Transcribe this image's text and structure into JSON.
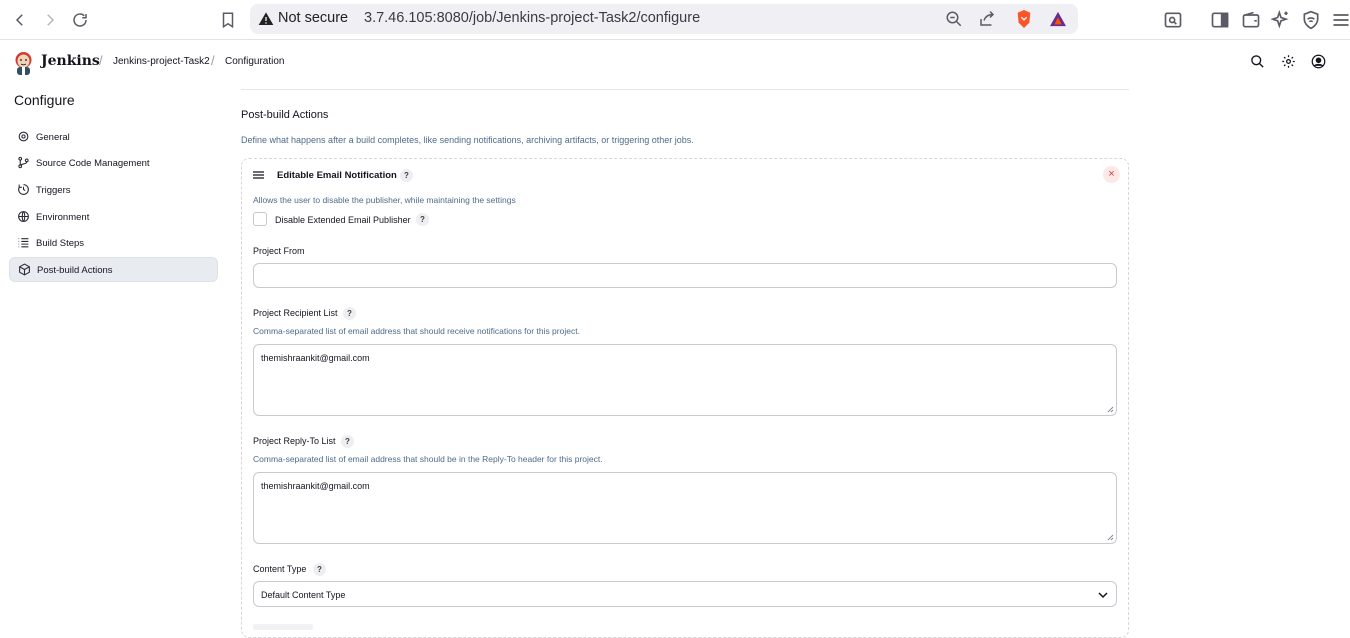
{
  "browser": {
    "url_warning": "Not secure",
    "url": "3.7.46.105:8080/job/Jenkins-project-Task2/configure"
  },
  "header": {
    "brand": "Jenkins",
    "breadcrumbs": [
      "Jenkins-project-Task2",
      "Configuration"
    ]
  },
  "sidebar": {
    "title": "Configure",
    "items": [
      {
        "label": "General",
        "icon": "gear-icon"
      },
      {
        "label": "Source Code Management",
        "icon": "git-branch-icon"
      },
      {
        "label": "Triggers",
        "icon": "clock-icon"
      },
      {
        "label": "Environment",
        "icon": "globe-icon"
      },
      {
        "label": "Build Steps",
        "icon": "list-icon"
      },
      {
        "label": "Post-build Actions",
        "icon": "package-icon",
        "active": true
      }
    ]
  },
  "main": {
    "section_title": "Post-build Actions",
    "section_desc": "Define what happens after a build completes, like sending notifications, archiving artifacts, or triggering other jobs.",
    "panel": {
      "title": "Editable Email Notification",
      "disable_desc": "Allows the user to disable the publisher, while maintaining the settings",
      "disable_label": "Disable Extended Email Publisher",
      "disable_checked": false,
      "project_from_label": "Project From",
      "project_from_value": "",
      "recipient_label": "Project Recipient List",
      "recipient_desc": "Comma-separated list of email address that should receive notifications for this project.",
      "recipient_value": "themishraankit@gmail.com",
      "replyto_label": "Project Reply-To List",
      "replyto_desc": "Comma-separated list of email address that should be in the Reply-To header for this project.",
      "replyto_value": "themishraankit@gmail.com",
      "content_type_label": "Content Type",
      "content_type_value": "Default Content Type"
    }
  },
  "help_symbol": "?",
  "close_symbol": "×"
}
